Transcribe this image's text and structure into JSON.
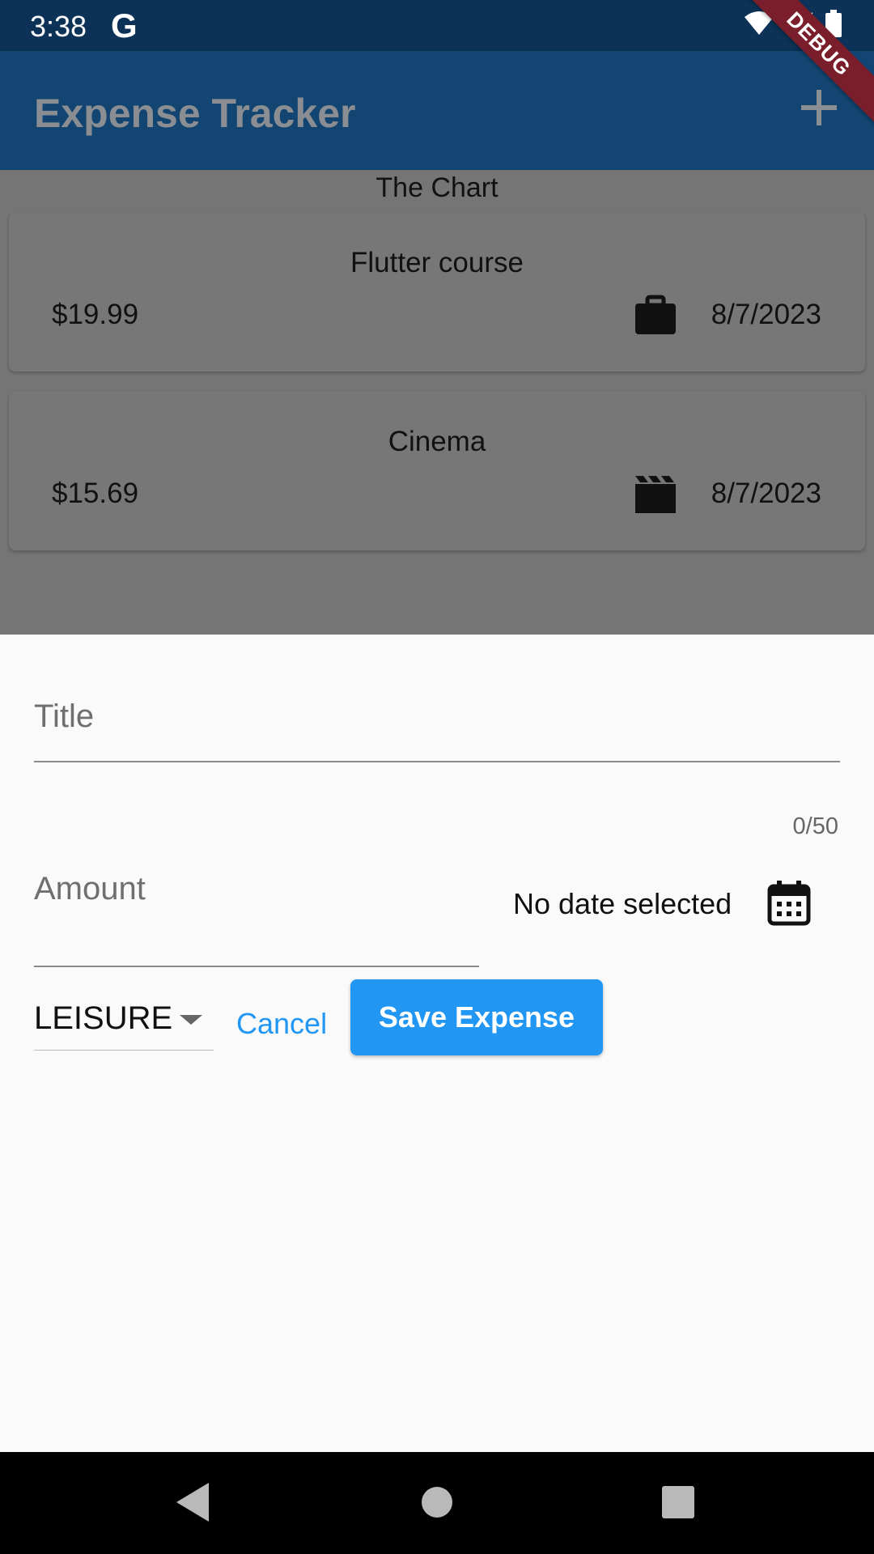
{
  "status_bar": {
    "time": "3:38",
    "g_logo": "G",
    "icons": [
      "wifi-icon",
      "signal-icon",
      "battery-icon"
    ]
  },
  "app_bar": {
    "title": "Expense Tracker",
    "add_icon": "plus-icon"
  },
  "debug_banner": {
    "label": "DEBUG"
  },
  "chart": {
    "label": "The Chart"
  },
  "expenses": [
    {
      "title": "Flutter course",
      "amount": "$19.99",
      "icon": "briefcase-icon",
      "date": "8/7/2023"
    },
    {
      "title": "Cinema",
      "amount": "$15.69",
      "icon": "movie-clapper-icon",
      "date": "8/7/2023"
    }
  ],
  "form": {
    "title_label": "Title",
    "title_value": "",
    "counter": "0/50",
    "amount_label": "Amount",
    "date_text": "No date selected",
    "calendar_icon": "calendar-icon",
    "category_value": "LEISURE",
    "cancel_label": "Cancel",
    "save_label": "Save Expense"
  },
  "nav_bar": {
    "buttons": [
      "back-icon",
      "home-icon",
      "recents-icon"
    ]
  },
  "colors": {
    "accent": "#2196f3",
    "app_bar": "#124571",
    "status_bar": "#0c3357",
    "scrim": "#757575"
  }
}
